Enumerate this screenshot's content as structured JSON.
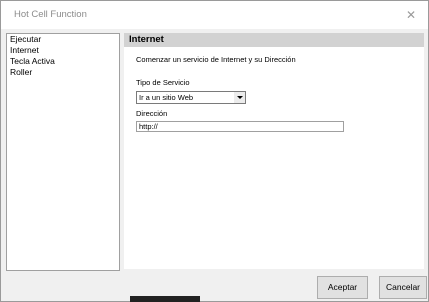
{
  "window": {
    "title": "Hot Cell Function",
    "close_glyph": "✕"
  },
  "sidebar": {
    "items": [
      {
        "label": "Ejecutar"
      },
      {
        "label": "Internet"
      },
      {
        "label": "Tecla Activa"
      },
      {
        "label": "Roller"
      }
    ]
  },
  "panel": {
    "title": "Internet",
    "description": "Comenzar un servicio de Internet y su Dirección",
    "service_label": "Tipo de Servicio",
    "service_value": "Ir a un sitio Web",
    "address_label": "Dirección",
    "address_value": "http://"
  },
  "buttons": {
    "accept": "Aceptar",
    "cancel": "Cancelar"
  }
}
